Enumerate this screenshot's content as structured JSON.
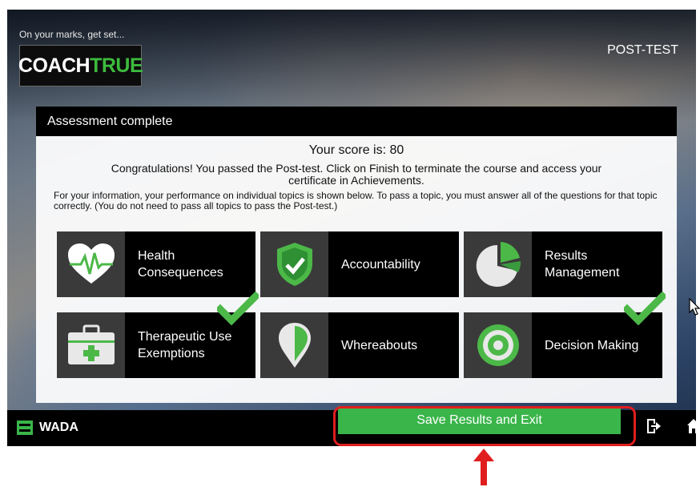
{
  "header": {
    "tagline": "On your marks, get set...",
    "logo_part1": "COACH",
    "logo_part2": "TRUE",
    "mode": "POST-TEST"
  },
  "panel": {
    "title": "Assessment complete",
    "score_line": "Your score is: 80",
    "congrats": "Congratulations! You passed the Post-test. Click on Finish to terminate the course and access your certificate in Achievements.",
    "info": "For your information, your performance on individual topics is shown below. To pass a topic, you must answer all of the questions for that topic correctly. (You do not need to pass all topics to pass the Post-test.)"
  },
  "topics": [
    {
      "label_line1": "Health",
      "label_line2": "Consequences",
      "icon": "heart-pulse-icon",
      "passed": false
    },
    {
      "label_line1": "Accountability",
      "label_line2": "",
      "icon": "shield-check-icon",
      "passed": false
    },
    {
      "label_line1": "Results",
      "label_line2": "Management",
      "icon": "pie-chart-icon",
      "passed": false
    },
    {
      "label_line1": "Therapeutic Use",
      "label_line2": "Exemptions",
      "icon": "medical-kit-icon",
      "passed": true
    },
    {
      "label_line1": "Whereabouts",
      "label_line2": "",
      "icon": "location-pin-icon",
      "passed": false
    },
    {
      "label_line1": "Decision Making",
      "label_line2": "",
      "icon": "target-icon",
      "passed": true
    }
  ],
  "footer": {
    "brand": "WADA",
    "save_label": "Save Results and Exit",
    "icons": [
      "exit-icon",
      "home-icon"
    ]
  },
  "colors": {
    "accent_green": "#3ab54a",
    "highlight_red": "#e01e1e"
  }
}
